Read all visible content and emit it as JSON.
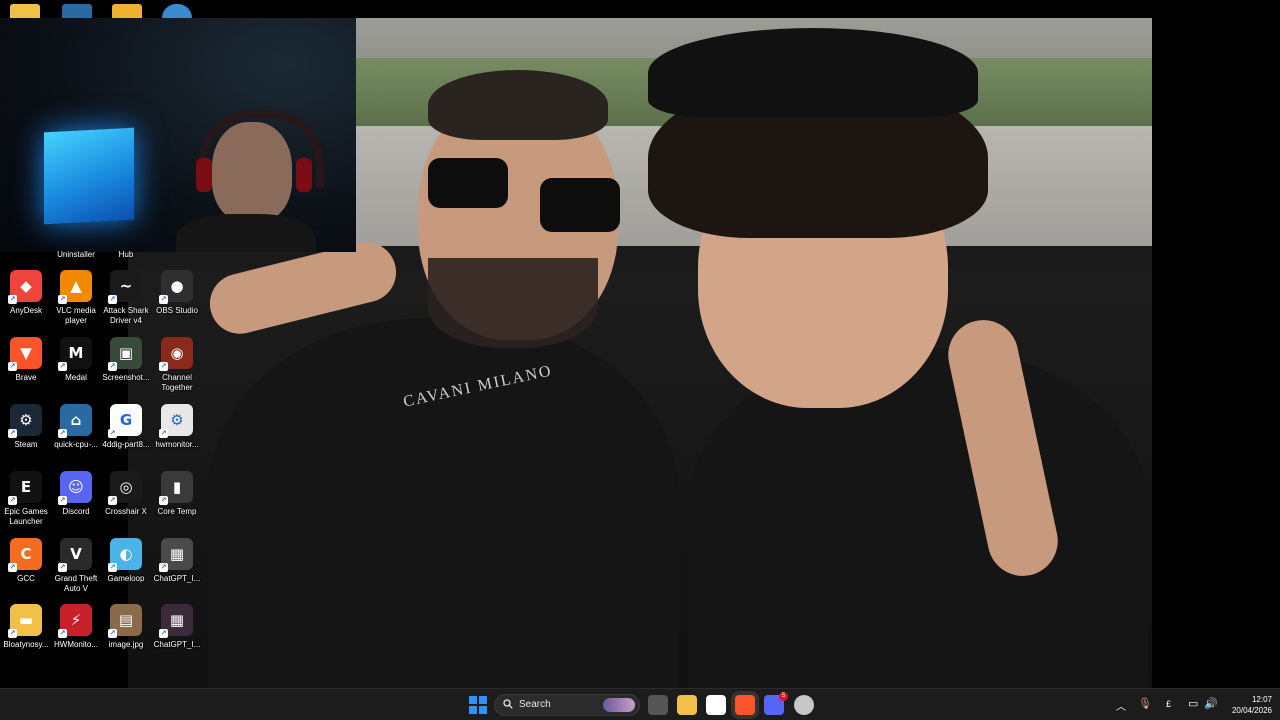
{
  "desktop": {
    "partial_labels": [
      "Uninstaller",
      "Hub"
    ],
    "icons": [
      {
        "label": "AnyDesk",
        "icon": "anydesk-icon",
        "color": "#ef443b",
        "glyph": "◆"
      },
      {
        "label": "VLC media player",
        "icon": "vlc-icon",
        "color": "#f28a00",
        "glyph": "▲"
      },
      {
        "label": "Attack Shark Driver v4",
        "icon": "attack-shark-icon",
        "color": "#1a1a1a",
        "glyph": "~"
      },
      {
        "label": "OBS Studio",
        "icon": "obs-icon",
        "color": "#302e31",
        "glyph": "●"
      },
      {
        "label": "Brave",
        "icon": "brave-icon",
        "color": "#fb542b",
        "glyph": "▼"
      },
      {
        "label": "Medal",
        "icon": "medal-icon",
        "color": "#111111",
        "glyph": "M"
      },
      {
        "label": "Screenshot...",
        "icon": "screenshot-icon",
        "color": "#3a4a3a",
        "glyph": "▣"
      },
      {
        "label": "Channel Together",
        "icon": "channel-together-icon",
        "color": "#8a2a1a",
        "glyph": "◉"
      },
      {
        "label": "Steam",
        "icon": "steam-icon",
        "color": "#1b2838",
        "glyph": "⚙"
      },
      {
        "label": "quick-cpu-...",
        "icon": "quick-cpu-icon",
        "color": "#2a6aa0",
        "glyph": "⌂"
      },
      {
        "label": "4ddig-part8...",
        "icon": "4ddig-icon",
        "color": "#ffffff",
        "glyph": "G"
      },
      {
        "label": "hwmonitor...",
        "icon": "hwmonitor-file-icon",
        "color": "#e8e8e8",
        "glyph": "⚙"
      },
      {
        "label": "Epic Games Launcher",
        "icon": "epic-games-icon",
        "color": "#121212",
        "glyph": "E"
      },
      {
        "label": "Discord",
        "icon": "discord-icon",
        "color": "#5865f2",
        "glyph": "☺"
      },
      {
        "label": "Crosshair X",
        "icon": "crosshair-icon",
        "color": "#1a1a1a",
        "glyph": "◎"
      },
      {
        "label": "Core Temp",
        "icon": "core-temp-icon",
        "color": "#3a3a3a",
        "glyph": "▮"
      },
      {
        "label": "GCC",
        "icon": "gcc-icon",
        "color": "#f36c21",
        "glyph": "C"
      },
      {
        "label": "Grand Theft Auto V",
        "icon": "gta-icon",
        "color": "#2a2a2a",
        "glyph": "V"
      },
      {
        "label": "Gameloop",
        "icon": "gameloop-icon",
        "color": "#4bb3e8",
        "glyph": "◐"
      },
      {
        "label": "ChatGPT_I...",
        "icon": "image-file-icon",
        "color": "#4a4a4a",
        "glyph": "▦"
      },
      {
        "label": "Bloatynosy...",
        "icon": "folder-icon",
        "color": "#f0c048",
        "glyph": "▬"
      },
      {
        "label": "HWMonito...",
        "icon": "hwmonitor-icon",
        "color": "#c8202a",
        "glyph": "⚡"
      },
      {
        "label": "image.jpg",
        "icon": "image-jpg-icon",
        "color": "#8a6a4a",
        "glyph": "▤"
      },
      {
        "label": "ChatGPT_I...",
        "icon": "image-file-icon",
        "color": "#3a2a3a",
        "glyph": "▦"
      }
    ]
  },
  "wallpaper": {
    "shirt_text": "CAVANI MILANO"
  },
  "taskbar": {
    "search_label": "Search",
    "apps": [
      {
        "name": "task-view-icon",
        "color": "#555555"
      },
      {
        "name": "file-explorer-icon",
        "color": "#f0c048"
      },
      {
        "name": "microsoft-store-icon",
        "color": "#ffffff"
      },
      {
        "name": "brave-taskbar-icon",
        "color": "#fb542b"
      },
      {
        "name": "discord-taskbar-icon",
        "color": "#5865f2"
      },
      {
        "name": "steam-taskbar-icon",
        "color": "#c7c7c7"
      }
    ],
    "discord_badge": "5",
    "currency": "£",
    "time": "12:07",
    "date": "20/04/2026"
  },
  "colors": {
    "taskbar_bg": "#1c1c1c",
    "accent": "#2f93f5"
  }
}
